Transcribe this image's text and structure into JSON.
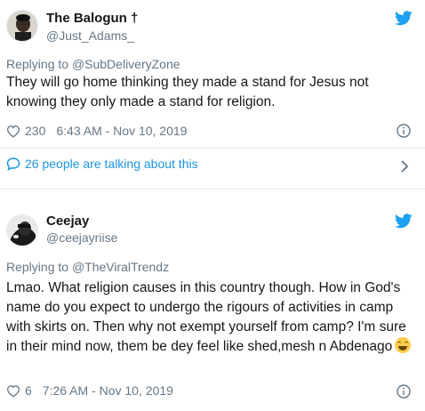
{
  "tweets": [
    {
      "name": "The Balogun †",
      "handle": "@Just_Adams_",
      "replying_prefix": "Replying to",
      "replying_to": "@SubDeliveryZone",
      "text": "They will go home thinking they made a stand for Jesus not knowing they only made a stand for religion.",
      "likes": "230",
      "timestamp": "6:43 AM - Nov 10, 2019",
      "talking": "26 people are talking about this"
    },
    {
      "name": "Ceejay",
      "handle": "@ceejayriise",
      "replying_prefix": "Replying to",
      "replying_to": "@TheViralTrendz",
      "text": "Lmao. What religion causes in this country though. How in God's name do you expect to undergo the rigours of activities in camp with skirts on. Then why not exempt yourself from camp? I'm sure in their mind now, them be dey feel like shed,mesh n Abdenago",
      "emoji": "grinning-face-emoji",
      "likes": "6",
      "timestamp": "7:26 AM - Nov 10, 2019"
    }
  ],
  "icons": {
    "twitter_bird": "twitter-bird-icon",
    "heart": "heart-icon",
    "info": "info-icon",
    "speech_bubble": "speech-bubble-icon",
    "chevron": "chevron-right-icon"
  },
  "colors": {
    "twitter_blue": "#1da1f2",
    "link_blue": "#1b95e0",
    "muted_gray": "#657786",
    "text": "#14171a"
  }
}
